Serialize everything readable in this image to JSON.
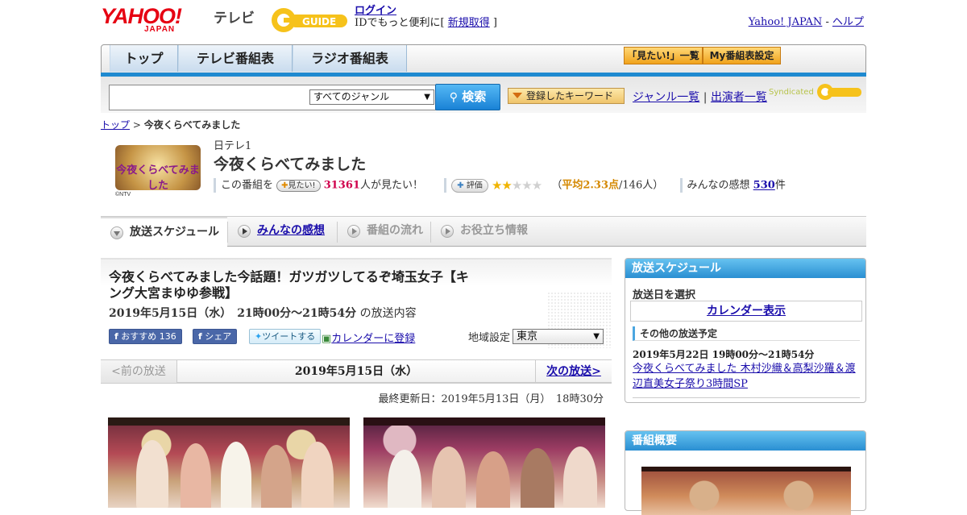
{
  "header": {
    "yahoo_logo": "YAHOO!",
    "yahoo_sub": "JAPAN",
    "tv_label": "テレビ",
    "guide_logo": "GUIDE",
    "login": "ログイン",
    "login_sub_prefix": "IDでもっと便利に[ ",
    "signup": "新規取得",
    "login_sub_suffix": " ]",
    "yahoo_japan_link": "Yahoo! JAPAN",
    "sep": " - ",
    "help_link": "ヘルプ"
  },
  "nav": {
    "tabs": [
      "トップ",
      "テレビ番組表",
      "ラジオ番組表"
    ],
    "mitai_list": "「見たい!」一覧",
    "my_bangumi": "My番組表設定"
  },
  "search": {
    "genre": "すべてのジャンル",
    "button": "検索",
    "keyword_btn": "登録したキーワード",
    "genre_list": "ジャンル一覧",
    "pipe": " | ",
    "performers": "出演者一覧",
    "syndicated": "Syndicated"
  },
  "breadcrumb": {
    "top": "トップ",
    "sep": " > ",
    "current": "今夜くらべてみました"
  },
  "program": {
    "logo_text": "今夜くらべてみました",
    "copyright": "©NTV",
    "channel": "日テレ1",
    "title": "今夜くらべてみました",
    "want_prefix": "この番組を",
    "want_btn": "見たい!",
    "want_count": "31361",
    "want_suffix": "人が見たい！",
    "rate_btn": "評価",
    "rating": 2.33,
    "avg_open": "（",
    "avg_label": "平均2.33点",
    "avg_rest": "/146人）",
    "comments_label": "みんなの感想",
    "comments_count": "530",
    "comments_unit": "件"
  },
  "tabs": [
    "放送スケジュール",
    "みんなの感想",
    "番組の流れ",
    "お役立ち情報"
  ],
  "article": {
    "title": "今夜くらべてみました今話題！ガツガツしてるぞ埼玉女子【キング大宮まゆゆ参戦】",
    "date": "2019年5月15日（水）　21時00分～21時54分",
    "date_suffix": "の放送内容",
    "recommend": "おすすめ 136",
    "fb_share": "シェア",
    "tweet": "ツイートする",
    "calendar": "カレンダーに登録",
    "region_label": "地域設定",
    "region": "東京",
    "prev": "<前の放送",
    "current_date": "2019年5月15日（水）",
    "next": "次の放送>",
    "updated": "最終更新日：2019年5月13日（月）　18時30分"
  },
  "sidebar": {
    "schedule_head": "放送スケジュール",
    "select_date": "放送日を選択",
    "calendar_view": "カレンダー表示",
    "other_schedule": "その他の放送予定",
    "other_date": "2019年5月22日  19時00分～21時54分",
    "other_title": "今夜くらべてみました 木村沙織＆高梨沙羅＆渡辺直美女子祭り3時間SP",
    "overview_head": "番組概要"
  },
  "colors": {
    "accent_blue": "#1f8ad0",
    "want_red": "#d0004c",
    "star_gold": "#f0b400",
    "yahoo_red": "#e60012"
  }
}
